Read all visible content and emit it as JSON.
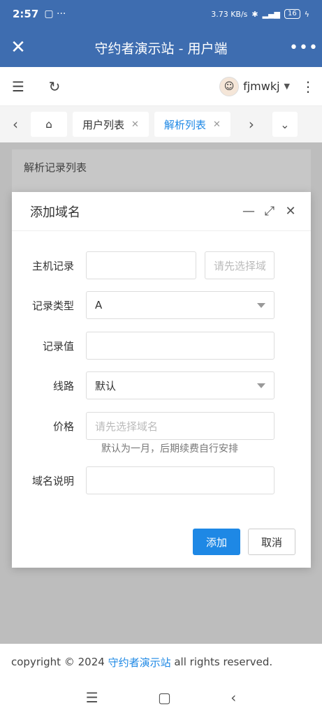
{
  "status": {
    "time": "2:57",
    "net_speed": "3.73 KB/s",
    "battery": "16"
  },
  "app": {
    "title": "守约者演示站 - 用户端"
  },
  "toolbar": {
    "username": "fjmwkj"
  },
  "tabs": [
    {
      "label": "用户列表"
    },
    {
      "label": "解析列表"
    }
  ],
  "page": {
    "card_title": "解析记录列表"
  },
  "dialog": {
    "title": "添加域名",
    "fields": {
      "host_label": "主机记录",
      "host_value": "",
      "domain_placeholder": "请先选择域名",
      "type_label": "记录类型",
      "type_value": "A",
      "value_label": "记录值",
      "value_value": "",
      "line_label": "线路",
      "line_value": "默认",
      "price_label": "价格",
      "price_placeholder": "请先选择域名",
      "price_hint": "默认为一月，后期续费自行安排",
      "desc_label": "域名说明",
      "desc_value": ""
    },
    "add_label": "添加",
    "cancel_label": "取消"
  },
  "footer": {
    "prefix": "copyright © 2024",
    "site": "守约者演示站",
    "suffix": "all rights reserved."
  },
  "icons": [
    "close-icon",
    "more-icon",
    "menu-icon",
    "refresh-icon",
    "avatar",
    "kebab-icon",
    "chevron-left-icon",
    "home-icon",
    "chevron-right-icon",
    "chevron-down-icon",
    "minimize-icon",
    "maximize-icon",
    "dialog-close-icon"
  ]
}
